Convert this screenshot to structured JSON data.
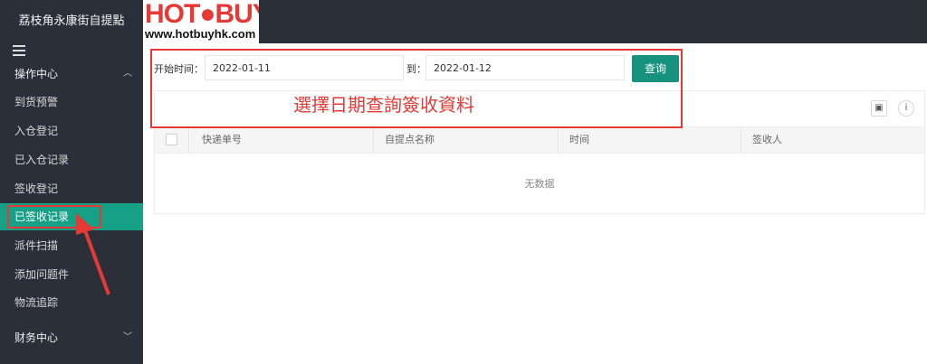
{
  "sidebar": {
    "title": "荔枝角永康街自提點",
    "groups": [
      {
        "label": "操作中心",
        "chevron": "chevron-up-icon"
      },
      {
        "label": "财务中心",
        "chevron": "chevron-down-icon"
      }
    ],
    "items": [
      {
        "label": "到货预警"
      },
      {
        "label": "入仓登记"
      },
      {
        "label": "已入仓记录"
      },
      {
        "label": "签收登记"
      },
      {
        "label": "已签收记录"
      },
      {
        "label": "派件扫描"
      },
      {
        "label": "添加问题件"
      },
      {
        "label": "物流追踪"
      }
    ],
    "active_item": "已签收记录",
    "accent_color": "#16a085"
  },
  "logo": {
    "main": "HOT●BUY",
    "sub": "www.hotbuyhk.com"
  },
  "filter": {
    "start_label": "开始时间：",
    "start_value": "2022-01-11",
    "end_label": "到：",
    "end_value": "2022-01-12",
    "query_label": "查询"
  },
  "annotation": {
    "text": "選擇日期查詢簽收資料",
    "color": "#e53935"
  },
  "table": {
    "columns": [
      "快递单号",
      "自提点名称",
      "时间",
      "签收人"
    ],
    "empty_text": "无数据",
    "tools": [
      "print-icon",
      "info-icon"
    ]
  }
}
